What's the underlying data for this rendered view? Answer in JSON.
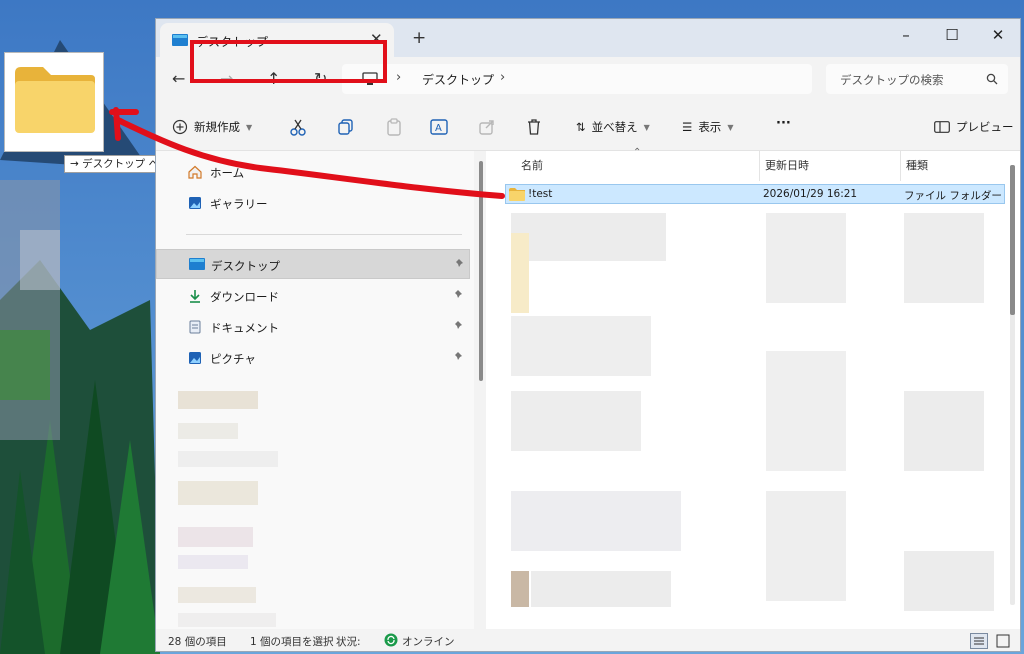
{
  "window": {
    "tab_title": "デスクトップ",
    "new_tab": "+",
    "minimize": "–",
    "maximize": "☐",
    "close": "✕"
  },
  "address": {
    "location": "デスクトップ",
    "chevron": "›",
    "search_placeholder": "デスクトップの検索"
  },
  "toolbar": {
    "new_label": "新規作成",
    "sort_label": "並べ替え",
    "view_label": "表示",
    "more_label": "···",
    "preview_label": "プレビュー"
  },
  "sidebar": {
    "items": [
      {
        "label": "ホーム",
        "icon": "home-icon"
      },
      {
        "label": "ギャラリー",
        "icon": "gallery-icon"
      },
      {
        "label": "デスクトップ",
        "icon": "desktop-icon"
      },
      {
        "label": "ダウンロード",
        "icon": "download-icon"
      },
      {
        "label": "ドキュメント",
        "icon": "document-icon"
      },
      {
        "label": "ピクチャ",
        "icon": "pictures-icon"
      }
    ]
  },
  "file_list": {
    "columns": [
      "名前",
      "更新日時",
      "種類"
    ],
    "rows": [
      {
        "name": "!test",
        "modified": "2026/01/29 16:21",
        "type": "ファイル フォルダー"
      }
    ]
  },
  "status": {
    "item_count": "28 個の項目",
    "selected": "1 個の項目を選択",
    "state_label": "状況:",
    "state_value": "オンライン"
  },
  "drag": {
    "tooltip": "→ デスクトップ へ移動"
  },
  "colors": {
    "accent": "#0067c0",
    "annotation": "#e10f1a",
    "selection": "#cce8ff"
  }
}
